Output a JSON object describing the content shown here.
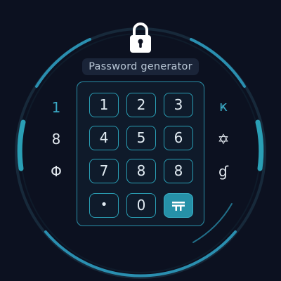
{
  "app": {
    "title": "Password generator"
  },
  "icons": {
    "lock": "lock-icon",
    "enter": "enter-key-icon"
  },
  "colors": {
    "background": "#0c1120",
    "accent": "#2a9fb5",
    "enter_key": "#2691a8",
    "title_pill": "#1a2438"
  },
  "keypad": {
    "rows": [
      [
        "1",
        "2",
        "3"
      ],
      [
        "4",
        "5",
        "6"
      ],
      [
        "7",
        "8",
        "8"
      ],
      [
        "•",
        "0",
        ""
      ]
    ]
  },
  "left_glyphs": [
    "1",
    "8",
    "Φ"
  ],
  "right_glyphs": [
    "ҝ",
    "✡",
    "ɠ"
  ]
}
